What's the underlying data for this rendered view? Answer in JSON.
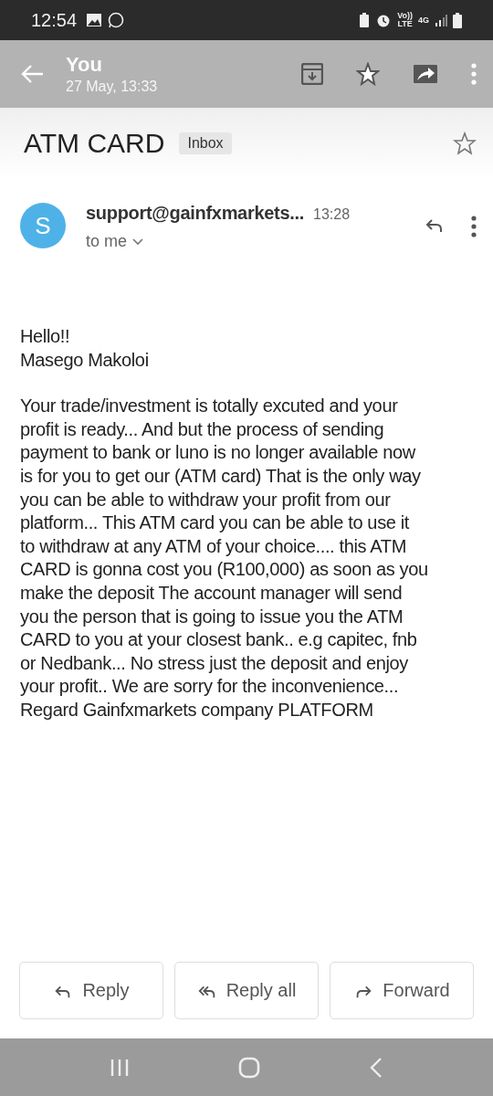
{
  "status_bar": {
    "time": "12:54",
    "volte": [
      "Vo))",
      "LTE"
    ],
    "network": "4G"
  },
  "app_bar": {
    "title": "You",
    "subtitle": "27 May, 13:33"
  },
  "subject": {
    "title": "ATM CARD",
    "label": "Inbox",
    "starred": false
  },
  "message": {
    "avatar_letter": "S",
    "sender": "support@gainfxmarkets...",
    "time": "13:28",
    "recipient": "to me",
    "greeting_lines": [
      "Hello!!",
      "Masego Makoloi"
    ],
    "body_lines": [
      "Your trade/investment is totally excuted and your",
      "profit is ready... And but the process of sending",
      "payment to bank or luno is no longer available now",
      "is for you to get our (ATM card) That is the only way",
      "you can be able to withdraw your profit from our",
      "platform... This ATM card you can be able to use it",
      "to withdraw at any ATM of your choice.... this ATM",
      "CARD is gonna cost you (R100,000) as soon as you",
      "make the deposit The account manager will send",
      "you the person that is going to issue you the ATM",
      "CARD to you at your closest bank.. e.g capitec, fnb",
      "or Nedbank... No stress just the deposit and enjoy",
      "your profit.. We are sorry for the inconvenience...",
      "Regard Gainfxmarkets company PLATFORM"
    ]
  },
  "actions": [
    {
      "kind": "reply",
      "label": "Reply"
    },
    {
      "kind": "reply_all",
      "label": "Reply all"
    },
    {
      "kind": "forward",
      "label": "Forward"
    }
  ]
}
